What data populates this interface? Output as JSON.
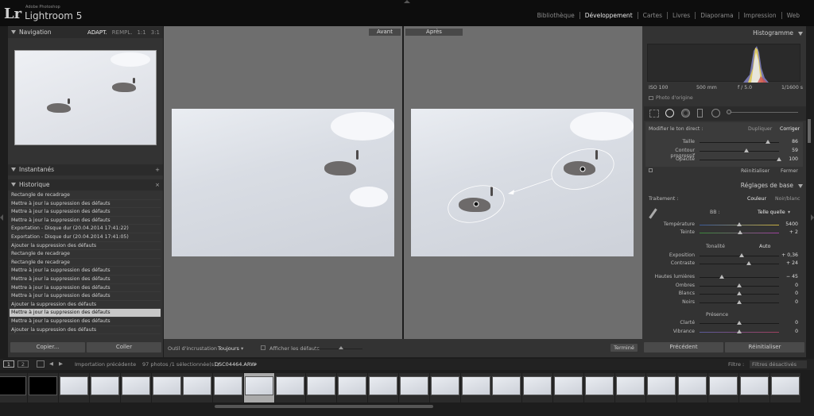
{
  "app": {
    "logo": "Lr",
    "vendor": "Adobe Photoshop",
    "name": "Lightroom 5"
  },
  "modules": [
    "Bibliothèque",
    "Développement",
    "Cartes",
    "Livres",
    "Diaporama",
    "Impression",
    "Web"
  ],
  "active_module": "Développement",
  "left_panel": {
    "navigation": {
      "title": "Navigation",
      "zoom": [
        "ADAPT.",
        "REMPL.",
        "1:1",
        "3:1"
      ]
    },
    "presets_title": "Instantanés",
    "history": {
      "title": "Historique",
      "items": [
        "Rectangle de recadrage",
        "Mettre à jour la suppression des défauts",
        "Mettre à jour la suppression des défauts",
        "Mettre à jour la suppression des défauts",
        "Exportation - Disque dur (20.04.2014 17:41:22)",
        "Exportation - Disque dur (20.04.2014 17:41:05)",
        "Ajouter la suppression des défauts",
        "Rectangle de recadrage",
        "Rectangle de recadrage",
        "Mettre à jour la suppression des défauts",
        "Mettre à jour la suppression des défauts",
        "Mettre à jour la suppression des défauts",
        "Mettre à jour la suppression des défauts",
        "Ajouter la suppression des défauts",
        "Mettre à jour la suppression des défauts",
        "Mettre à jour la suppression des défauts",
        "Ajouter la suppression des défauts"
      ],
      "selected_index": 14
    },
    "copy_btn": "Copier...",
    "paste_btn": "Coller"
  },
  "center": {
    "before_label": "Avant",
    "after_label": "Après",
    "toolbar": {
      "overlay_label": "Outil d'incrustation :",
      "overlay_value": "Toujours",
      "show_defaults": "Afficher les défauts",
      "done": "Terminé"
    }
  },
  "right_panel": {
    "histogram_title": "Histogramme",
    "exif": [
      "ISO 100",
      "500 mm",
      "f / 5.0",
      "1/1600 s"
    ],
    "original_photo": "Photo d'origine",
    "spot": {
      "mode_label": "Modifier le ton direct :",
      "duplicate": "Dupliquer",
      "correct": "Corriger",
      "sliders": [
        {
          "label": "Taille",
          "value": "86",
          "pos": 0.86
        },
        {
          "label": "Contour progressif",
          "value": "59",
          "pos": 0.59
        },
        {
          "label": "Opacité",
          "value": "100",
          "pos": 1.0
        }
      ],
      "reset": "Réinitialiser",
      "close": "Fermer"
    },
    "basic": {
      "title": "Réglages de base",
      "treatment_label": "Traitement :",
      "color": "Couleur",
      "bw": "Noir/blanc",
      "wb_label": "BB :",
      "wb_value": "Telle quelle",
      "temp": [
        {
          "label": "Température",
          "value": "5400",
          "pos": 0.5
        },
        {
          "label": "Teinte",
          "value": "+ 2",
          "pos": 0.51
        }
      ],
      "tone_label": "Tonalité",
      "auto": "Auto",
      "tone": [
        {
          "label": "Exposition",
          "value": "+ 0,36",
          "pos": 0.53
        },
        {
          "label": "Contraste",
          "value": "+ 24",
          "pos": 0.62
        }
      ],
      "tone2": [
        {
          "label": "Hautes lumières",
          "value": "− 45",
          "pos": 0.28
        },
        {
          "label": "Ombres",
          "value": "0",
          "pos": 0.5
        },
        {
          "label": "Blancs",
          "value": "0",
          "pos": 0.5
        },
        {
          "label": "Noirs",
          "value": "0",
          "pos": 0.5
        }
      ],
      "presence_label": "Présence",
      "presence": [
        {
          "label": "Clarté",
          "value": "0",
          "pos": 0.5
        },
        {
          "label": "Vibrance",
          "value": "0",
          "pos": 0.5
        }
      ]
    },
    "prev_btn": "Précédent",
    "reset_btn": "Réinitialiser"
  },
  "filmstrip": {
    "pages": [
      "1",
      "2"
    ],
    "source": "Importation précédente",
    "count": "97 photos /1 sélectionnée(s) /",
    "filename": "DSC04464.ARW",
    "filter_label": "Filtre :",
    "filter_value": "Filtres désactivés"
  },
  "colors": {
    "accent": "#e8e8e8",
    "bg": "#333333"
  }
}
